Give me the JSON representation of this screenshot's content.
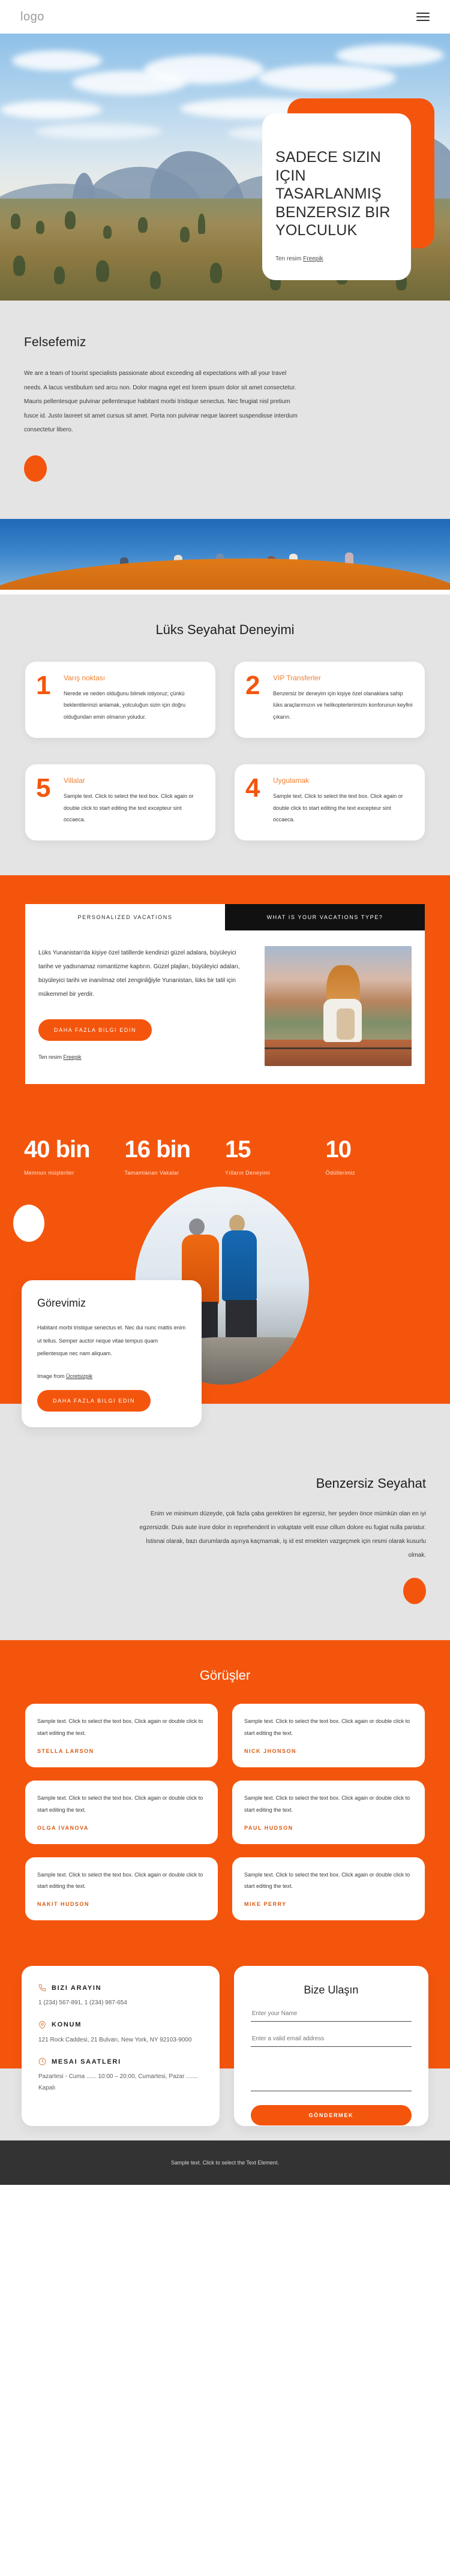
{
  "header": {
    "logo": "logo",
    "menu_icon": "hamburger-icon"
  },
  "hero": {
    "title": "SADECE SIZIN IÇIN TASARLANMIŞ BENZERSIZ BIR YOLCULUK",
    "credit_prefix": "Ten resim ",
    "credit_link": "Freepik"
  },
  "philosophy": {
    "heading": "Felsefemiz",
    "body": "We are a team of tourist specialists passionate about exceeding all expectations with all your travel needs. A lacus vestibulum sed arcu non. Dolor magna eget est lorem ipsum dolor sit amet consectetur. Mauris pellentesque pulvinar pellentesque habitant morbi tristique senectus. Nec feugiat nisl pretium fusce id. Justo laoreet sit amet cursus sit amet. Porta non pulvinar neque laoreet suspendisse interdum consectetur libero."
  },
  "luxury": {
    "heading": "Lüks Seyahat Deneyimi",
    "cards": [
      {
        "number": "1",
        "title": "Varış noktası",
        "text": "Nerede ve neden olduğunu bilmek istiyoruz; çünkü beklentilerinizi anlamak, yolculuğun sizin için doğru olduğundan emin olmanın yoludur."
      },
      {
        "number": "2",
        "title": "VIP Transferler",
        "text": "Benzersiz bir deneyim için kişiye özel olanaklara sahip lüks araçlarımızın ve helikopterlerimizin konforunun keyfini çıkarın."
      },
      {
        "number": "5",
        "title": "Villalar",
        "text": "Sample text. Click to select the text box. Click again or double click to start editing the text excepteur sint occaeca."
      },
      {
        "number": "4",
        "title": "Uygulamak",
        "text": "Sample text. Click to select the text box. Click again or double click to start editing the text excepteur sint occaeca."
      }
    ]
  },
  "vacations": {
    "tab_active": "PERSONALIZED VACATIONS",
    "tab_dark": "WHAT IS YOUR VACATIONS TYPE?",
    "body": "Lüks Yunanistan'da kişiye özel tatillerde kendinizi güzel adalara, büyüleyici tarihe ve yadsınamaz romantizme kaptırın. Güzel plajları, büyüleyici adaları, büyüleyici tarihi ve inanılmaz otel zenginliğiyle Yunanistan, lüks bir tatil için mükemmel bir yerdir.",
    "button": "DAHA FAZLA BILGI EDIN",
    "credit_prefix": "Ten resim ",
    "credit_link": "Freepik"
  },
  "stats": [
    {
      "value": "40 bin",
      "label": "Memnun müşteriler"
    },
    {
      "value": "16 bin",
      "label": "Tamamlanan Vakalar"
    },
    {
      "value": "15",
      "label": "Yılların Deneyimi"
    },
    {
      "value": "10",
      "label": "Ödüllerimiz"
    }
  ],
  "mission": {
    "heading": "Görevimiz",
    "body": "Habitant morbi tristique senectus et. Nec dui nunc mattis enim ut tellus. Semper auctor neque vitae tempus quam pellentesque nec nam aliquam.",
    "credit_prefix": "Image from ",
    "credit_link": "Ücretsizpik",
    "button": "DAHA FAZLA BILGI EDIN"
  },
  "unique": {
    "heading": "Benzersiz Seyahat",
    "body": "Enim ve minimum düzeyde, çok fazla çaba gerektiren bir egzersiz, her şeyden önce mümkün olan en iyi egzersizdir. Duis aute irure dolor in reprehenderit in voluptate velit esse cillum dolore eu fugiat nulla pariatur. İstisnai olarak, bazı durumlarda aşırıya kaçmamak, iş id est emekten vazgeçmek için resmi olarak kusurlu olmak."
  },
  "testimonials": {
    "heading": "Görüşler",
    "items": [
      {
        "text": "Sample text. Click to select the text box. Click again or double click to start editing the text.",
        "name": "STELLA LARSON"
      },
      {
        "text": "Sample text. Click to select the text box. Click again or double click to start editing the text.",
        "name": "NICK JHONSON"
      },
      {
        "text": "Sample text. Click to select the text box. Click again or double click to start editing the text.",
        "name": "OLGA IVANOVA"
      },
      {
        "text": "Sample text. Click to select the text box. Click again or double click to start editing the text.",
        "name": "PAUL HUDSON"
      },
      {
        "text": "Sample text. Click to select the text box. Click again or double click to start editing the text.",
        "name": "NAKIT HUDSON"
      },
      {
        "text": "Sample text. Click to select the text box. Click again or double click to start editing the text.",
        "name": "MIKE PERRY"
      }
    ]
  },
  "contact": {
    "call_title": "BIZI ARAYIN",
    "call_value": "1 (234) 567-891, 1 (234) 987-654",
    "location_title": "KONUM",
    "location_value": "121 Rock Caddesi, 21 Bulvarı, New York, NY 92103-9000",
    "hours_title": "MESAI SAATLERI",
    "hours_value": "Pazartesi - Cuma ...... 10:00 – 20:00, Cumartesi, Pazar ....... Kapalı",
    "form_title": "Bize Ulaşın",
    "name_placeholder": "Enter your Name",
    "email_placeholder": "Enter a valid email address",
    "message_placeholder": "",
    "submit": "GÖNDERMEK"
  },
  "footer": {
    "text": "Sample text. Click to select the Text Element."
  },
  "colors": {
    "accent": "#f4550d",
    "gray_bg": "#e4e4e4",
    "dark": "#333333",
    "title_orange": "#f08030"
  }
}
